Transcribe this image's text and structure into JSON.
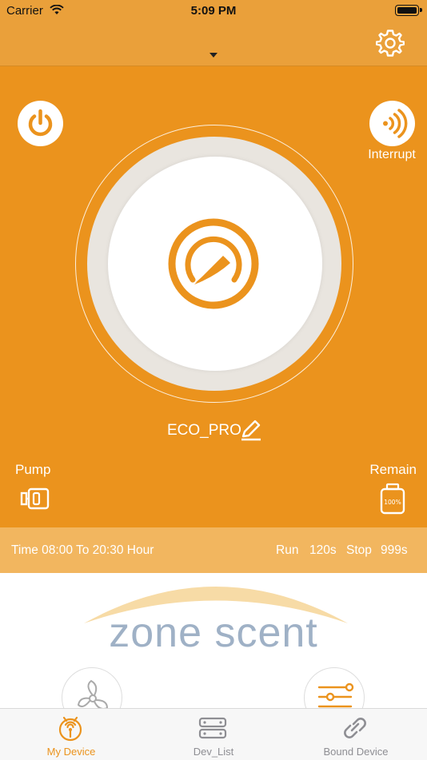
{
  "status_bar": {
    "carrier": "Carrier",
    "time": "5:09 PM"
  },
  "header": {
    "dropdown_icon": "caret-down-icon",
    "settings_icon": "gear-icon"
  },
  "controls": {
    "power_icon": "power-icon",
    "interrupt_icon": "signal-waves-icon",
    "interrupt_label": "Interrupt",
    "device_name": "ECO_PRO",
    "edit_icon": "pencil-icon",
    "pump_label": "Pump",
    "remain_label": "Remain",
    "remain_level_text": "100%"
  },
  "schedule": {
    "time_text": "Time 08:00 To 20:30 Hour",
    "run_label": "Run",
    "run_value": "120s",
    "stop_label": "Stop",
    "stop_value": "999s"
  },
  "brand": {
    "logo_text": "zone scent"
  },
  "tabs": [
    {
      "label": "My Device",
      "icon": "device-signal-icon",
      "active": true
    },
    {
      "label": "Dev_List",
      "icon": "server-list-icon",
      "active": false
    },
    {
      "label": "Bound Device",
      "icon": "link-icon",
      "active": false
    }
  ],
  "colors": {
    "accent": "#eb931d",
    "header": "#eaa03a",
    "schedule_strip": "#f2b65f",
    "tab_active": "#eb931d",
    "tab_inactive": "#8e8e93",
    "logo_text": "#9fb1c6"
  }
}
